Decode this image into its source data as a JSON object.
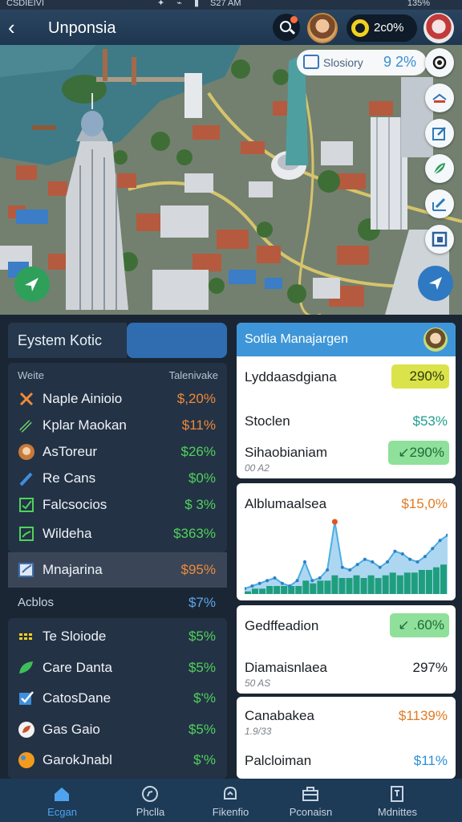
{
  "status_bar": {
    "carrier": "CSDIEIVI",
    "time": "S27 AM",
    "battery": "135%"
  },
  "header": {
    "title": "Unponsia",
    "coins": "2c0%"
  },
  "map": {
    "search_label": "Slosiory",
    "search_value": "9 2%"
  },
  "left_panel": {
    "tab_active": "Eystem Kotic",
    "list_header_left": "Weite",
    "list_header_right": "Talenivake",
    "items": [
      {
        "label": "Naple Ainioio",
        "value": "$,20%",
        "icon": "close-x-icon",
        "color": "#f08a3a"
      },
      {
        "label": "Kplar Maokan",
        "value": "$11%",
        "icon": "pencil-icon",
        "color": "#f08a3a"
      },
      {
        "label": "AsToreur",
        "value": "$26%",
        "icon": "person-icon",
        "color": "#4fd35b"
      },
      {
        "label": "Re Cans",
        "value": "$0%",
        "icon": "pen-icon",
        "color": "#4fd35b"
      },
      {
        "label": "Falcsocios",
        "value": "$ 3%",
        "icon": "checkbox-icon",
        "color": "#4fd35b"
      },
      {
        "label": "Wildeha",
        "value": "$363%",
        "icon": "chart-check-icon",
        "color": "#4fd35b"
      }
    ],
    "highlight": {
      "label": "Mnajarina",
      "value": "$95%",
      "icon": "edit-box-icon",
      "color": "#f08a3a"
    },
    "sub": {
      "label": "Acblos",
      "value": "$7%"
    },
    "items2": [
      {
        "label": "Te Sloiode",
        "value": "$5%",
        "icon": "grid-dots-icon",
        "color": "#4fd35b"
      },
      {
        "label": "Care Danta",
        "value": "$5%",
        "icon": "leaf-icon",
        "color": "#4fd35b"
      },
      {
        "label": "CatosDane",
        "value": "$'%",
        "icon": "check-note-icon",
        "color": "#4fd35b"
      },
      {
        "label": "Gas Gaio",
        "value": "$5%",
        "icon": "leaf-circle-icon",
        "color": "#4fd35b"
      },
      {
        "label": "GarokJnabl",
        "value": "$'%",
        "icon": "orange-circle-icon",
        "color": "#4fd35b"
      }
    ]
  },
  "right_panel": {
    "head_title": "Sotlia Manajargen",
    "card1": {
      "row1_label": "Lyddaasdgiana",
      "row1_badge": "290%",
      "row2_label": "Stoclen",
      "row2_value": "$53%",
      "row3_label": "Sihaobianiam",
      "row3_badge": "↙290%",
      "row3_sub": "00 A2"
    },
    "card2": {
      "title": "Alblumaalsea",
      "value": "$15,0%"
    },
    "card3": {
      "row1_label": "Gedffeadion",
      "row1_badge": "↙ .60%",
      "row2_label": "Diamaisnlaea",
      "row2_value": "297%",
      "row2_sub": "50 AS"
    },
    "card4": {
      "row1_label": "Canabakea",
      "row1_value": "$1139%",
      "row1_sub": "1.9/33",
      "row2_label": "Palcloiman",
      "row2_value": "$11%"
    }
  },
  "chart_data": {
    "type": "area",
    "x": [
      1,
      2,
      3,
      4,
      5,
      6,
      7,
      8,
      9,
      10,
      11,
      12,
      13,
      14,
      15,
      16,
      17,
      18,
      19,
      20,
      21,
      22,
      23,
      24,
      25,
      26,
      27,
      28
    ],
    "series": [
      {
        "values": [
          2,
          3,
          4,
          5,
          6,
          4,
          3,
          5,
          12,
          5,
          6,
          9,
          27,
          10,
          9,
          11,
          13,
          12,
          10,
          12,
          16,
          15,
          13,
          12,
          14,
          17,
          20,
          22
        ]
      },
      {
        "values": [
          1,
          2,
          2,
          3,
          3,
          3,
          3,
          3,
          5,
          4,
          5,
          5,
          7,
          6,
          6,
          7,
          6,
          7,
          6,
          7,
          8,
          7,
          8,
          8,
          9,
          9,
          10,
          11
        ]
      }
    ],
    "colors": [
      "#4aaee6",
      "#1f9e7e"
    ],
    "ylim": [
      0,
      30
    ]
  },
  "bottom_nav": [
    {
      "label": "Ecgan",
      "icon": "home-icon",
      "active": true
    },
    {
      "label": "Phclla",
      "icon": "compass-icon",
      "active": false
    },
    {
      "label": "Fikenfio",
      "icon": "bell-icon",
      "active": false
    },
    {
      "label": "Pconaisn",
      "icon": "toolbox-icon",
      "active": false
    },
    {
      "label": "Mdnittes",
      "icon": "document-icon",
      "active": false
    }
  ]
}
